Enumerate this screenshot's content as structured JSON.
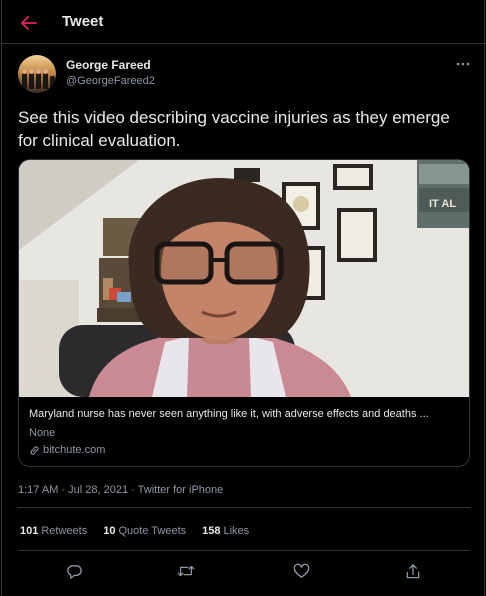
{
  "header": {
    "title": "Tweet",
    "back_icon": "arrow-left-icon",
    "accent_color": "#e0245e"
  },
  "author": {
    "name": "George Fareed",
    "handle": "@GeorgeFareed2"
  },
  "tweet": {
    "text": "See this video describing vaccine injuries as they emerge for clinical evaluation.",
    "timestamp": "1:17 AM · Jul 28, 2021",
    "separator": " · ",
    "source": "Twitter for iPhone"
  },
  "card": {
    "title": "Maryland nurse has never seen anything like it, with adverse effects and deaths ...",
    "description": "None",
    "domain": "bitchute.com",
    "sign_text": "IT AL"
  },
  "stats": {
    "retweets_count": "101",
    "retweets_label": "Retweets",
    "quotes_count": "10",
    "quotes_label": "Quote Tweets",
    "likes_count": "158",
    "likes_label": "Likes"
  },
  "actions": [
    "reply-icon",
    "retweet-icon",
    "like-icon",
    "share-icon"
  ],
  "colors": {
    "background": "#000000",
    "text_primary": "#e7e9ea",
    "text_secondary": "#8b98a5",
    "border": "#2f3336"
  }
}
